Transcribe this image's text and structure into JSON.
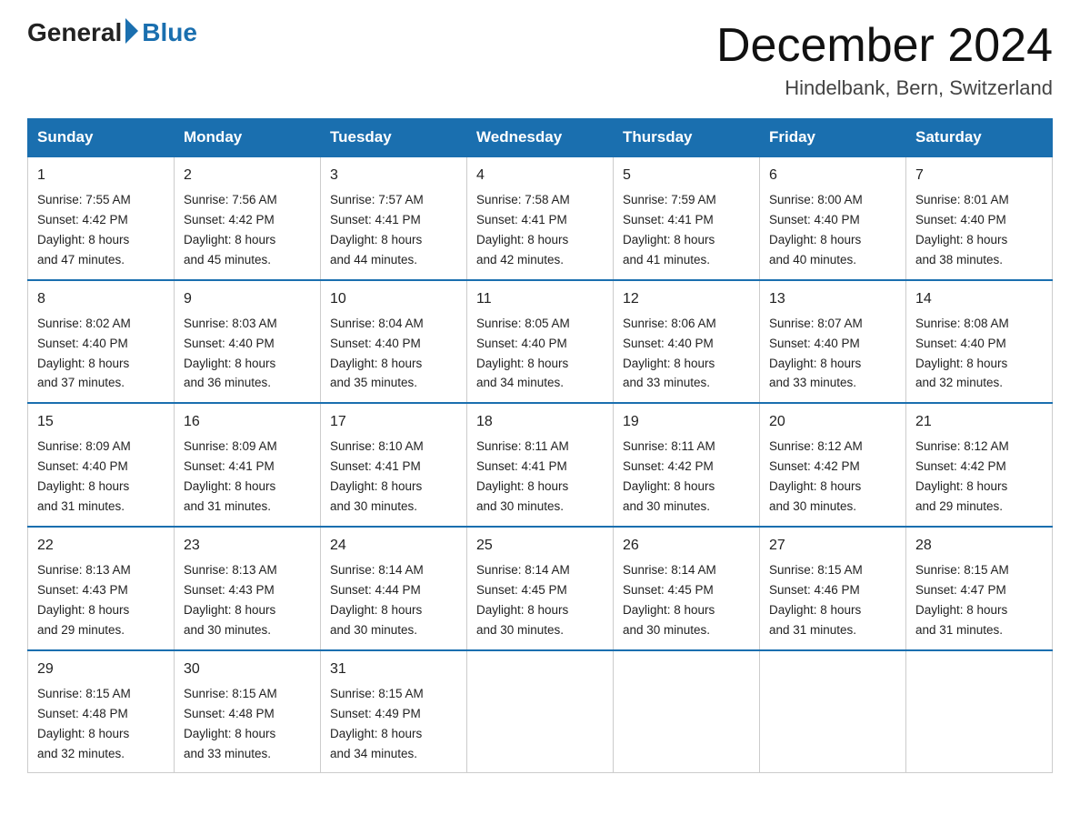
{
  "logo": {
    "general": "General",
    "blue": "Blue"
  },
  "title": "December 2024",
  "location": "Hindelbank, Bern, Switzerland",
  "days_of_week": [
    "Sunday",
    "Monday",
    "Tuesday",
    "Wednesday",
    "Thursday",
    "Friday",
    "Saturday"
  ],
  "weeks": [
    [
      {
        "day": "1",
        "sunrise": "7:55 AM",
        "sunset": "4:42 PM",
        "daylight": "8 hours and 47 minutes."
      },
      {
        "day": "2",
        "sunrise": "7:56 AM",
        "sunset": "4:42 PM",
        "daylight": "8 hours and 45 minutes."
      },
      {
        "day": "3",
        "sunrise": "7:57 AM",
        "sunset": "4:41 PM",
        "daylight": "8 hours and 44 minutes."
      },
      {
        "day": "4",
        "sunrise": "7:58 AM",
        "sunset": "4:41 PM",
        "daylight": "8 hours and 42 minutes."
      },
      {
        "day": "5",
        "sunrise": "7:59 AM",
        "sunset": "4:41 PM",
        "daylight": "8 hours and 41 minutes."
      },
      {
        "day": "6",
        "sunrise": "8:00 AM",
        "sunset": "4:40 PM",
        "daylight": "8 hours and 40 minutes."
      },
      {
        "day": "7",
        "sunrise": "8:01 AM",
        "sunset": "4:40 PM",
        "daylight": "8 hours and 38 minutes."
      }
    ],
    [
      {
        "day": "8",
        "sunrise": "8:02 AM",
        "sunset": "4:40 PM",
        "daylight": "8 hours and 37 minutes."
      },
      {
        "day": "9",
        "sunrise": "8:03 AM",
        "sunset": "4:40 PM",
        "daylight": "8 hours and 36 minutes."
      },
      {
        "day": "10",
        "sunrise": "8:04 AM",
        "sunset": "4:40 PM",
        "daylight": "8 hours and 35 minutes."
      },
      {
        "day": "11",
        "sunrise": "8:05 AM",
        "sunset": "4:40 PM",
        "daylight": "8 hours and 34 minutes."
      },
      {
        "day": "12",
        "sunrise": "8:06 AM",
        "sunset": "4:40 PM",
        "daylight": "8 hours and 33 minutes."
      },
      {
        "day": "13",
        "sunrise": "8:07 AM",
        "sunset": "4:40 PM",
        "daylight": "8 hours and 33 minutes."
      },
      {
        "day": "14",
        "sunrise": "8:08 AM",
        "sunset": "4:40 PM",
        "daylight": "8 hours and 32 minutes."
      }
    ],
    [
      {
        "day": "15",
        "sunrise": "8:09 AM",
        "sunset": "4:40 PM",
        "daylight": "8 hours and 31 minutes."
      },
      {
        "day": "16",
        "sunrise": "8:09 AM",
        "sunset": "4:41 PM",
        "daylight": "8 hours and 31 minutes."
      },
      {
        "day": "17",
        "sunrise": "8:10 AM",
        "sunset": "4:41 PM",
        "daylight": "8 hours and 30 minutes."
      },
      {
        "day": "18",
        "sunrise": "8:11 AM",
        "sunset": "4:41 PM",
        "daylight": "8 hours and 30 minutes."
      },
      {
        "day": "19",
        "sunrise": "8:11 AM",
        "sunset": "4:42 PM",
        "daylight": "8 hours and 30 minutes."
      },
      {
        "day": "20",
        "sunrise": "8:12 AM",
        "sunset": "4:42 PM",
        "daylight": "8 hours and 30 minutes."
      },
      {
        "day": "21",
        "sunrise": "8:12 AM",
        "sunset": "4:42 PM",
        "daylight": "8 hours and 29 minutes."
      }
    ],
    [
      {
        "day": "22",
        "sunrise": "8:13 AM",
        "sunset": "4:43 PM",
        "daylight": "8 hours and 29 minutes."
      },
      {
        "day": "23",
        "sunrise": "8:13 AM",
        "sunset": "4:43 PM",
        "daylight": "8 hours and 30 minutes."
      },
      {
        "day": "24",
        "sunrise": "8:14 AM",
        "sunset": "4:44 PM",
        "daylight": "8 hours and 30 minutes."
      },
      {
        "day": "25",
        "sunrise": "8:14 AM",
        "sunset": "4:45 PM",
        "daylight": "8 hours and 30 minutes."
      },
      {
        "day": "26",
        "sunrise": "8:14 AM",
        "sunset": "4:45 PM",
        "daylight": "8 hours and 30 minutes."
      },
      {
        "day": "27",
        "sunrise": "8:15 AM",
        "sunset": "4:46 PM",
        "daylight": "8 hours and 31 minutes."
      },
      {
        "day": "28",
        "sunrise": "8:15 AM",
        "sunset": "4:47 PM",
        "daylight": "8 hours and 31 minutes."
      }
    ],
    [
      {
        "day": "29",
        "sunrise": "8:15 AM",
        "sunset": "4:48 PM",
        "daylight": "8 hours and 32 minutes."
      },
      {
        "day": "30",
        "sunrise": "8:15 AM",
        "sunset": "4:48 PM",
        "daylight": "8 hours and 33 minutes."
      },
      {
        "day": "31",
        "sunrise": "8:15 AM",
        "sunset": "4:49 PM",
        "daylight": "8 hours and 34 minutes."
      },
      null,
      null,
      null,
      null
    ]
  ],
  "labels": {
    "sunrise": "Sunrise:",
    "sunset": "Sunset:",
    "daylight": "Daylight:"
  }
}
